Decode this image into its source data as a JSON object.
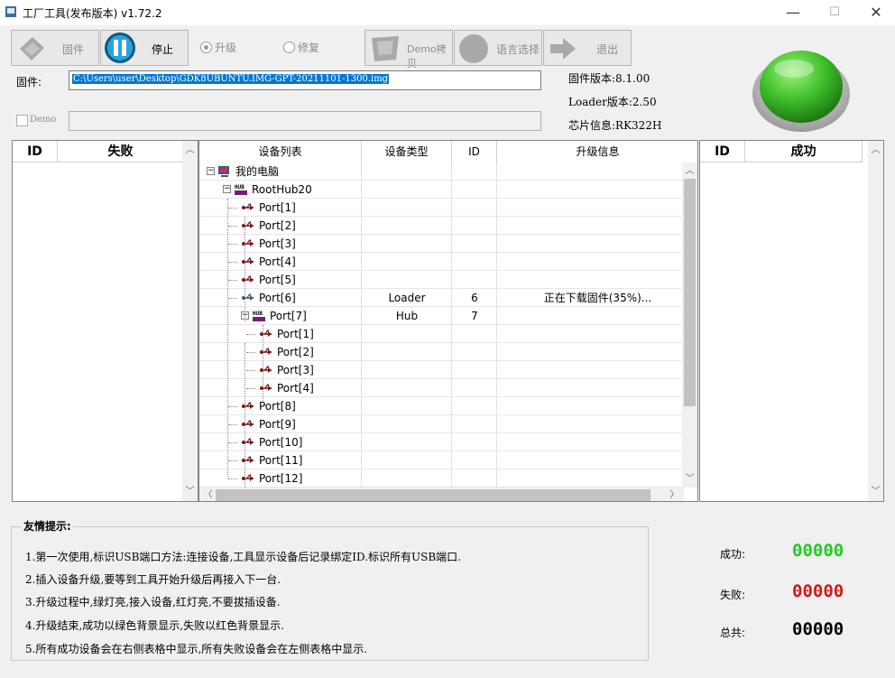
{
  "window": {
    "title": "工厂工具(发布版本) v1.72.2",
    "minimize": "—",
    "maximize": "☐",
    "close": "✕"
  },
  "toolbar": {
    "firmware_label": "固件",
    "stop_label": "停止",
    "upgrade_radio": "升级",
    "repair_radio": "修复",
    "demo_copy_label": "Demo拷贝",
    "language_label": "语言选择",
    "exit_label": "退出"
  },
  "firmware": {
    "label": "固件:",
    "path": "C:\\Users\\user\\Desktop\\GDK8UBUNTU.IMG-GPT-20211101-1300.img"
  },
  "demo": {
    "label": "Demo",
    "path": ""
  },
  "info": {
    "fw_version": "固件版本:8.1.00",
    "loader_version": "Loader版本:2.50",
    "chip_info": "芯片信息:RK322H"
  },
  "status_light_color": "#3fbf2a",
  "fail_panel": {
    "col_id": "ID",
    "col_status": "失败"
  },
  "success_panel": {
    "col_id": "ID",
    "col_status": "成功"
  },
  "device_tree": {
    "headers": [
      "设备列表",
      "设备类型",
      "ID",
      "升级信息"
    ],
    "rows": [
      {
        "name": "我的电脑",
        "type": "",
        "id": "",
        "info": ""
      },
      {
        "name": "RootHub20",
        "type": "",
        "id": "",
        "info": ""
      },
      {
        "name": "Port[1]",
        "type": "",
        "id": "",
        "info": ""
      },
      {
        "name": "Port[2]",
        "type": "",
        "id": "",
        "info": ""
      },
      {
        "name": "Port[3]",
        "type": "",
        "id": "",
        "info": ""
      },
      {
        "name": "Port[4]",
        "type": "",
        "id": "",
        "info": ""
      },
      {
        "name": "Port[5]",
        "type": "",
        "id": "",
        "info": ""
      },
      {
        "name": "Port[6]",
        "type": "Loader",
        "id": "6",
        "info": "正在下载固件(35%)..."
      },
      {
        "name": "Port[7]",
        "type": "Hub",
        "id": "7",
        "info": ""
      },
      {
        "name": "Port[1]",
        "type": "",
        "id": "",
        "info": ""
      },
      {
        "name": "Port[2]",
        "type": "",
        "id": "",
        "info": ""
      },
      {
        "name": "Port[3]",
        "type": "",
        "id": "",
        "info": ""
      },
      {
        "name": "Port[4]",
        "type": "",
        "id": "",
        "info": ""
      },
      {
        "name": "Port[8]",
        "type": "",
        "id": "",
        "info": ""
      },
      {
        "name": "Port[9]",
        "type": "",
        "id": "",
        "info": ""
      },
      {
        "name": "Port[10]",
        "type": "",
        "id": "",
        "info": ""
      },
      {
        "name": "Port[11]",
        "type": "",
        "id": "",
        "info": ""
      },
      {
        "name": "Port[12]",
        "type": "",
        "id": "",
        "info": ""
      }
    ]
  },
  "tips": {
    "title": "友情提示:",
    "items": [
      "1.第一次使用,标识USB端口方法:连接设备,工具显示设备后记录绑定ID.标识所有USB端口.",
      "2.插入设备升级,要等到工具开始升级后再接入下一台.",
      "3.升级过程中,绿灯亮,接入设备,红灯亮,不要拔插设备.",
      "4.升级结束,成功以绿色背景显示,失败以红色背景显示.",
      "5.所有成功设备会在右侧表格中显示,所有失败设备会在左侧表格中显示."
    ]
  },
  "counters": {
    "success_label": "成功:",
    "success_value": "00000",
    "success_color": "#22c922",
    "fail_label": "失败:",
    "fail_value": "00000",
    "fail_color": "#d01818",
    "total_label": "总共:",
    "total_value": "00000"
  }
}
